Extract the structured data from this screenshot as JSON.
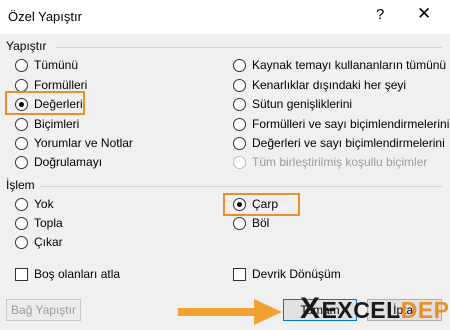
{
  "dialog": {
    "title": "Özel Yapıştır",
    "help_glyph": "?",
    "close_glyph": "✕"
  },
  "paste": {
    "section_title": "Yapıştır",
    "left_options": [
      {
        "label": "Tümünü",
        "selected": false
      },
      {
        "label": "Formülleri",
        "selected": false
      },
      {
        "label": "Değerleri",
        "selected": true
      },
      {
        "label": "Biçimleri",
        "selected": false
      },
      {
        "label": "Yorumlar ve Notlar",
        "selected": false
      },
      {
        "label": "Doğrulamayı",
        "selected": false
      }
    ],
    "right_options": [
      {
        "label": "Kaynak temayı kullananların tümünü",
        "selected": false
      },
      {
        "label": "Kenarlıklar dışındaki her şeyi",
        "selected": false
      },
      {
        "label": "Sütun genişliklerini",
        "selected": false
      },
      {
        "label": "Formülleri ve sayı biçimlendirmelerini",
        "selected": false
      },
      {
        "label": "Değerleri ve sayı biçimlendirmelerini",
        "selected": false
      },
      {
        "label": "Tüm birleştirilmiş koşullu biçimler",
        "selected": false,
        "disabled": true
      }
    ]
  },
  "operation": {
    "section_title": "İşlem",
    "left_options": [
      {
        "label": "Yok",
        "selected": false
      },
      {
        "label": "Topla",
        "selected": false
      },
      {
        "label": "Çıkar",
        "selected": false
      }
    ],
    "right_options": [
      {
        "label": "Çarp",
        "selected": true
      },
      {
        "label": "Böl",
        "selected": false
      }
    ]
  },
  "checkboxes": {
    "skip_blanks": "Boş olanları atla",
    "transpose": "Devrik Dönüşüm"
  },
  "buttons": {
    "paste_link": "Bağ Yapıştır",
    "ok": "Tamam",
    "cancel": "İptal"
  },
  "watermark": {
    "x": "X",
    "excel": "EXCEL",
    "depo": "DEPO"
  },
  "colors": {
    "highlight": "#e8902a",
    "arrow": "#f0a030",
    "logo_dark": "#1a1a1a",
    "logo_accent": "#e8902a"
  }
}
